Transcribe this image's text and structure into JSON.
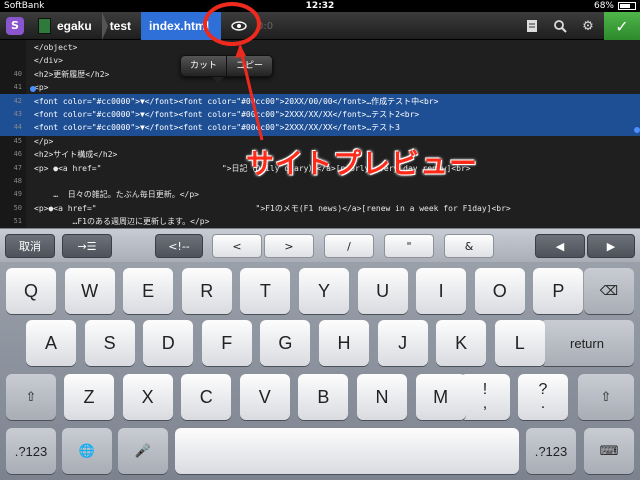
{
  "status_bar": {
    "carrier": "SoftBank",
    "time": "12:32",
    "battery_percent": "68%",
    "battery_level": 0.68
  },
  "toolbar": {
    "app_icon": "S",
    "breadcrumbs": [
      "egaku",
      "test",
      "index.html"
    ],
    "eye_icon": "eye-icon",
    "line_col": "0:0"
  },
  "editor": {
    "lines": [
      {
        "num": "",
        "code": "</object>",
        "selected": false
      },
      {
        "num": "",
        "code": "</div>",
        "selected": false
      },
      {
        "num": "40",
        "code": "<h2>更新履歴</h2>",
        "selected": false
      },
      {
        "num": "41",
        "code": "<p>",
        "selected": false
      },
      {
        "num": "42",
        "code": "<font color=\"#cc0000\">▼</font><font color=\"#00cc00\">20XX/00/00</font>…作成テスト中<br>",
        "selected": true
      },
      {
        "num": "43",
        "code": "<font color=\"#cc0000\">▼</font><font color=\"#00cc00\">2XXX/XX/XX</font>…テスト2<br>",
        "selected": true
      },
      {
        "num": "44",
        "code": "<font color=\"#cc0000\">▼</font><font color=\"#00cc00\">2XXX/XX/XX</font>…テスト3",
        "selected": true
      },
      {
        "num": "45",
        "code": "</p>",
        "selected": false
      },
      {
        "num": "46",
        "code": "<h2>サイト構成</h2>",
        "selected": false
      },
      {
        "num": "47",
        "code": "<p> ●<a href=\"                         \">日記（Daily diary）</a>[poorly every day renew]<br>",
        "selected": false
      },
      {
        "num": "48",
        "code": "",
        "selected": false
      },
      {
        "num": "49",
        "code": "    …  日々の雑記。たぶん毎日更新。</p>",
        "selected": false
      },
      {
        "num": "50",
        "code": "<p>●<a href=\"                                 \">F1のメモ(F1 news)</a>[renew in a week for F1day]<br>",
        "selected": false
      },
      {
        "num": "51",
        "code": "        …F1のある週周辺に更新します。</p>",
        "selected": false
      }
    ]
  },
  "context_menu": {
    "items": [
      "カット",
      "コピー"
    ]
  },
  "annotation": {
    "label": "サイトプレビュー"
  },
  "accessory": {
    "undo": "取消",
    "indent": "→☰",
    "comment": "<!--",
    "lt": "<",
    "gt": ">",
    "slash": "/",
    "quote": "\"",
    "amp": "&",
    "left": "◀",
    "right": "▶"
  },
  "keyboard": {
    "row1": [
      "Q",
      "W",
      "E",
      "R",
      "T",
      "Y",
      "U",
      "I",
      "O",
      "P"
    ],
    "row2": [
      "A",
      "S",
      "D",
      "F",
      "G",
      "H",
      "J",
      "K",
      "L"
    ],
    "row3": [
      "Z",
      "X",
      "C",
      "V",
      "B",
      "N",
      "M"
    ],
    "excl": {
      "top": "!",
      "bottom": ","
    },
    "ques": {
      "top": "?",
      "bottom": "."
    },
    "backspace": "⌫",
    "return": "return",
    "shift": "⇧",
    "numbers": ".?123",
    "globe": "🌐",
    "mic": "🎤",
    "hide": "⌨"
  }
}
